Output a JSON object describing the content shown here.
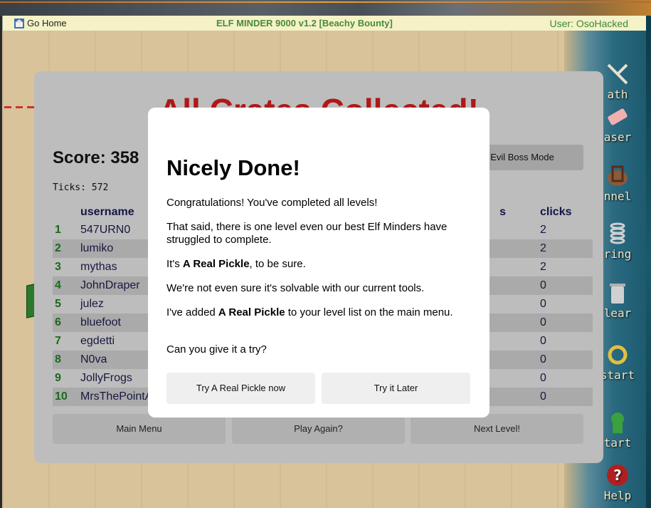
{
  "header": {
    "home_label": "Go Home",
    "title": "ELF MINDER 9000 v1.2 [Beachy Bounty]",
    "user": "User: OsoHacked"
  },
  "tools": [
    {
      "label": "Path",
      "shown": "ath",
      "icon": "path-icon"
    },
    {
      "label": "Eraser",
      "shown": "aser",
      "icon": "eraser-icon"
    },
    {
      "label": "Tunnel",
      "shown": "nnel",
      "icon": "tunnel-icon"
    },
    {
      "label": "Spring",
      "shown": "ring",
      "icon": "spring-icon"
    },
    {
      "label": "Clear",
      "shown": "lear",
      "icon": "trash-icon"
    },
    {
      "label": "Restart",
      "shown": "start",
      "icon": "restart-icon"
    },
    {
      "label": "Start",
      "shown": "tart",
      "icon": "elf-icon"
    },
    {
      "label": "Help",
      "shown": "Help",
      "icon": "help-icon"
    }
  ],
  "results": {
    "title": "All Crates Collected!",
    "score": "Score: 358",
    "ticks": "Ticks: 572",
    "evil_boss_button": "Evil Boss Mode",
    "columns": {
      "username": "username",
      "levels": "levels",
      "levels_shown": "s",
      "clicks": "clicks"
    },
    "rows": [
      {
        "rank": "1",
        "username": "547URN0",
        "clicks": "2"
      },
      {
        "rank": "2",
        "username": "lumiko",
        "clicks": "2"
      },
      {
        "rank": "3",
        "username": "mythas",
        "clicks": "2"
      },
      {
        "rank": "4",
        "username": "JohnDraper",
        "clicks": "0"
      },
      {
        "rank": "5",
        "username": "julez",
        "clicks": "0"
      },
      {
        "rank": "6",
        "username": "bluefoot",
        "clicks": "0"
      },
      {
        "rank": "7",
        "username": "egdetti",
        "clicks": "0"
      },
      {
        "rank": "8",
        "username": "N0va",
        "clicks": "0"
      },
      {
        "rank": "9",
        "username": "JollyFrogs",
        "clicks": "0"
      },
      {
        "rank": "10",
        "username": "MrsThePointA",
        "clicks": "0"
      }
    ],
    "buttons": {
      "main_menu": "Main Menu",
      "play_again": "Play Again?",
      "next_level": "Next Level!"
    }
  },
  "modal": {
    "title": "Nicely Done!",
    "p1": "Congratulations! You've completed all levels!",
    "p2": "That said, there is one level even our best Elf Minders have struggled to complete.",
    "p3_prefix": "It's ",
    "p3_bold": "A Real Pickle",
    "p3_suffix": ", to be sure.",
    "p4": "We're not even sure it's solvable with our current tools.",
    "p5_prefix": "I've added ",
    "p5_bold": "A Real Pickle",
    "p5_suffix": " to your level list on the main menu.",
    "p6": "Can you give it a try?",
    "btn_try_now": "Try A Real Pickle now",
    "btn_later": "Try it Later"
  },
  "colors": {
    "title_red": "#b01818",
    "rank_green": "#1a6a1a",
    "header_bg": "#f5f2c8",
    "header_title_green": "#4a8a3a"
  }
}
